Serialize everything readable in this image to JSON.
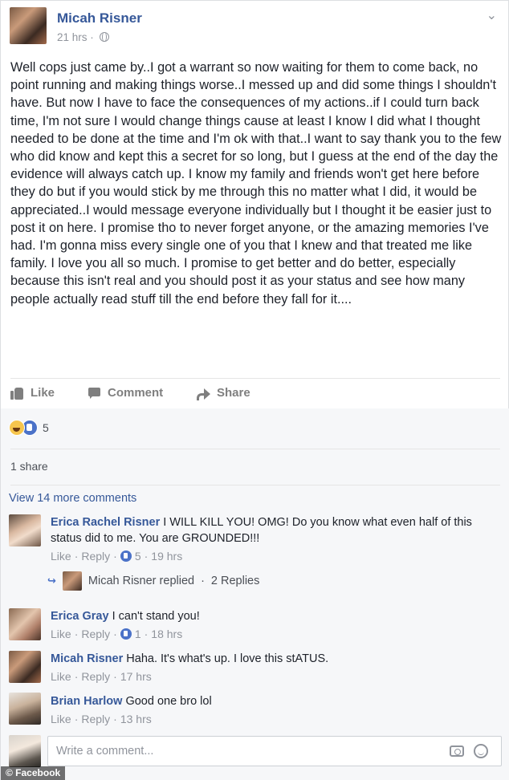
{
  "post": {
    "author": "Micah Risner",
    "time": "21 hrs",
    "dot": "·",
    "text": "Well cops just came by..I got a warrant so now waiting for them to come back, no point running and making things worse..I messed up and did some things I shouldn't have. But now I have to face the consequences of my actions..if I could turn back time, I'm not sure I would change things cause at least I know I did what I thought needed to be done at the time and I'm ok with that..I want to say thank you to the few who did know and kept this a secret for so long, but I guess at the end of the day the evidence will always catch up. I know my family and friends won't get here before they do but if you would stick by me through this no matter what I did, it would be appreciated..I would message everyone individually but I thought it be easier just to post it on here. I promise tho to never forget anyone, or the amazing memories I've had. I'm gonna miss every single one of you that I knew and that treated me like family. I love you all so much. I promise to get better and do better, especially because this isn't real and you should post it as your status and see how many people actually read stuff till the end before they fall for it...."
  },
  "actions": {
    "like": "Like",
    "comment": "Comment",
    "share": "Share"
  },
  "reactions": {
    "count": "5"
  },
  "shares": "1 share",
  "view_more": "View 14 more comments",
  "comments": [
    {
      "name": "Erica Rachel Risner",
      "text": " I WILL KILL YOU! OMG! Do you know what even half of this status did to me. You are GROUNDED!!!",
      "like": "Like",
      "reply": "Reply",
      "reactions": "5",
      "time": "19 hrs"
    },
    {
      "name": "Erica Gray",
      "text": " I can't stand you!",
      "like": "Like",
      "reply": "Reply",
      "reactions": "1",
      "time": "18 hrs"
    },
    {
      "name": "Micah Risner",
      "text": " Haha. It's what's up. I love this stATUS.",
      "like": "Like",
      "reply": "Reply",
      "time": "17 hrs"
    },
    {
      "name": "Brian Harlow",
      "text": " Good one bro lol",
      "like": "Like",
      "reply": "Reply",
      "time": "13 hrs"
    }
  ],
  "reply_summary": {
    "name": "Micah Risner",
    "action": "replied",
    "count": "2 Replies"
  },
  "composer": {
    "placeholder": "Write a comment..."
  },
  "credit": "© Facebook",
  "colors": {
    "link": "#365899",
    "muted": "#90949c",
    "like_blue": "#4b72c8",
    "gray_bg": "#f6f7f9"
  },
  "icons": [
    "globe-icon",
    "options-chevron-icon",
    "like-icon",
    "comment-icon",
    "share-icon",
    "haha-reaction-icon",
    "like-reaction-icon",
    "reply-arrow-icon",
    "camera-icon",
    "smiley-icon"
  ]
}
